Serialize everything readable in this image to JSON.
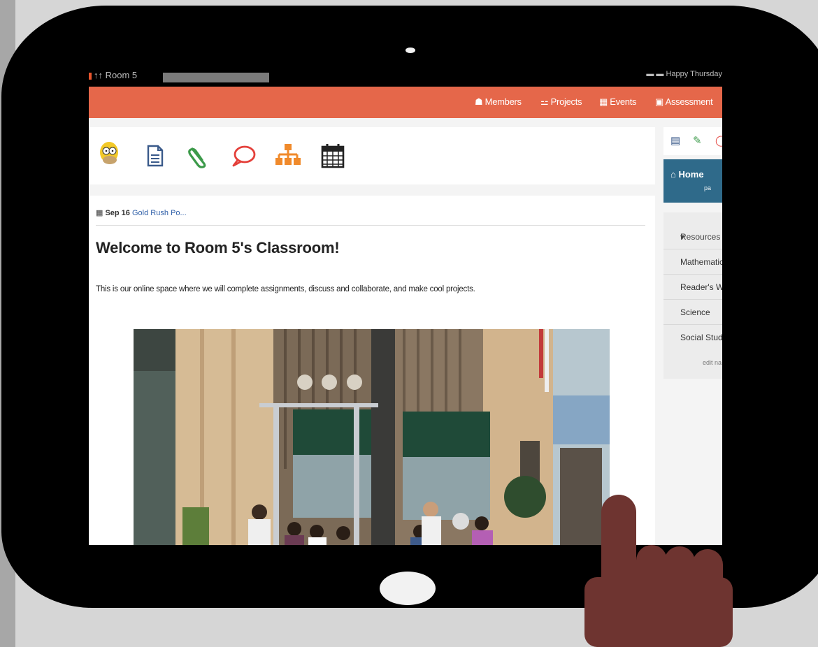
{
  "status": {
    "left_text": "↑↑ Room 5",
    "right_text": "Happy Thursday"
  },
  "nav": {
    "members": "Members",
    "projects": "Projects",
    "events": "Events",
    "assessment": "Assessment"
  },
  "toolbar": {
    "icons": [
      "avatar-homer",
      "document-icon",
      "paperclip-icon",
      "speech-bubble-icon",
      "org-chart-icon",
      "calendar-icon"
    ]
  },
  "post": {
    "date": "Sep 16",
    "link": "Gold Rush Po...",
    "title": "Welcome to Room 5's Classroom!",
    "body": "This is our online space where we will complete assignments, discuss and collaborate, and make cool projects."
  },
  "sidebar": {
    "home_title": "Home",
    "home_sub": "pa",
    "resources": "Resources",
    "items": [
      "Mathematic",
      "Reader's W",
      "Science",
      "Social Stud"
    ],
    "edit": "edit na"
  },
  "colors": {
    "navbar": "#e5674a",
    "sidebar_home": "#2f6a8a",
    "link": "#2f5fa8",
    "hand": "#6e3430"
  }
}
